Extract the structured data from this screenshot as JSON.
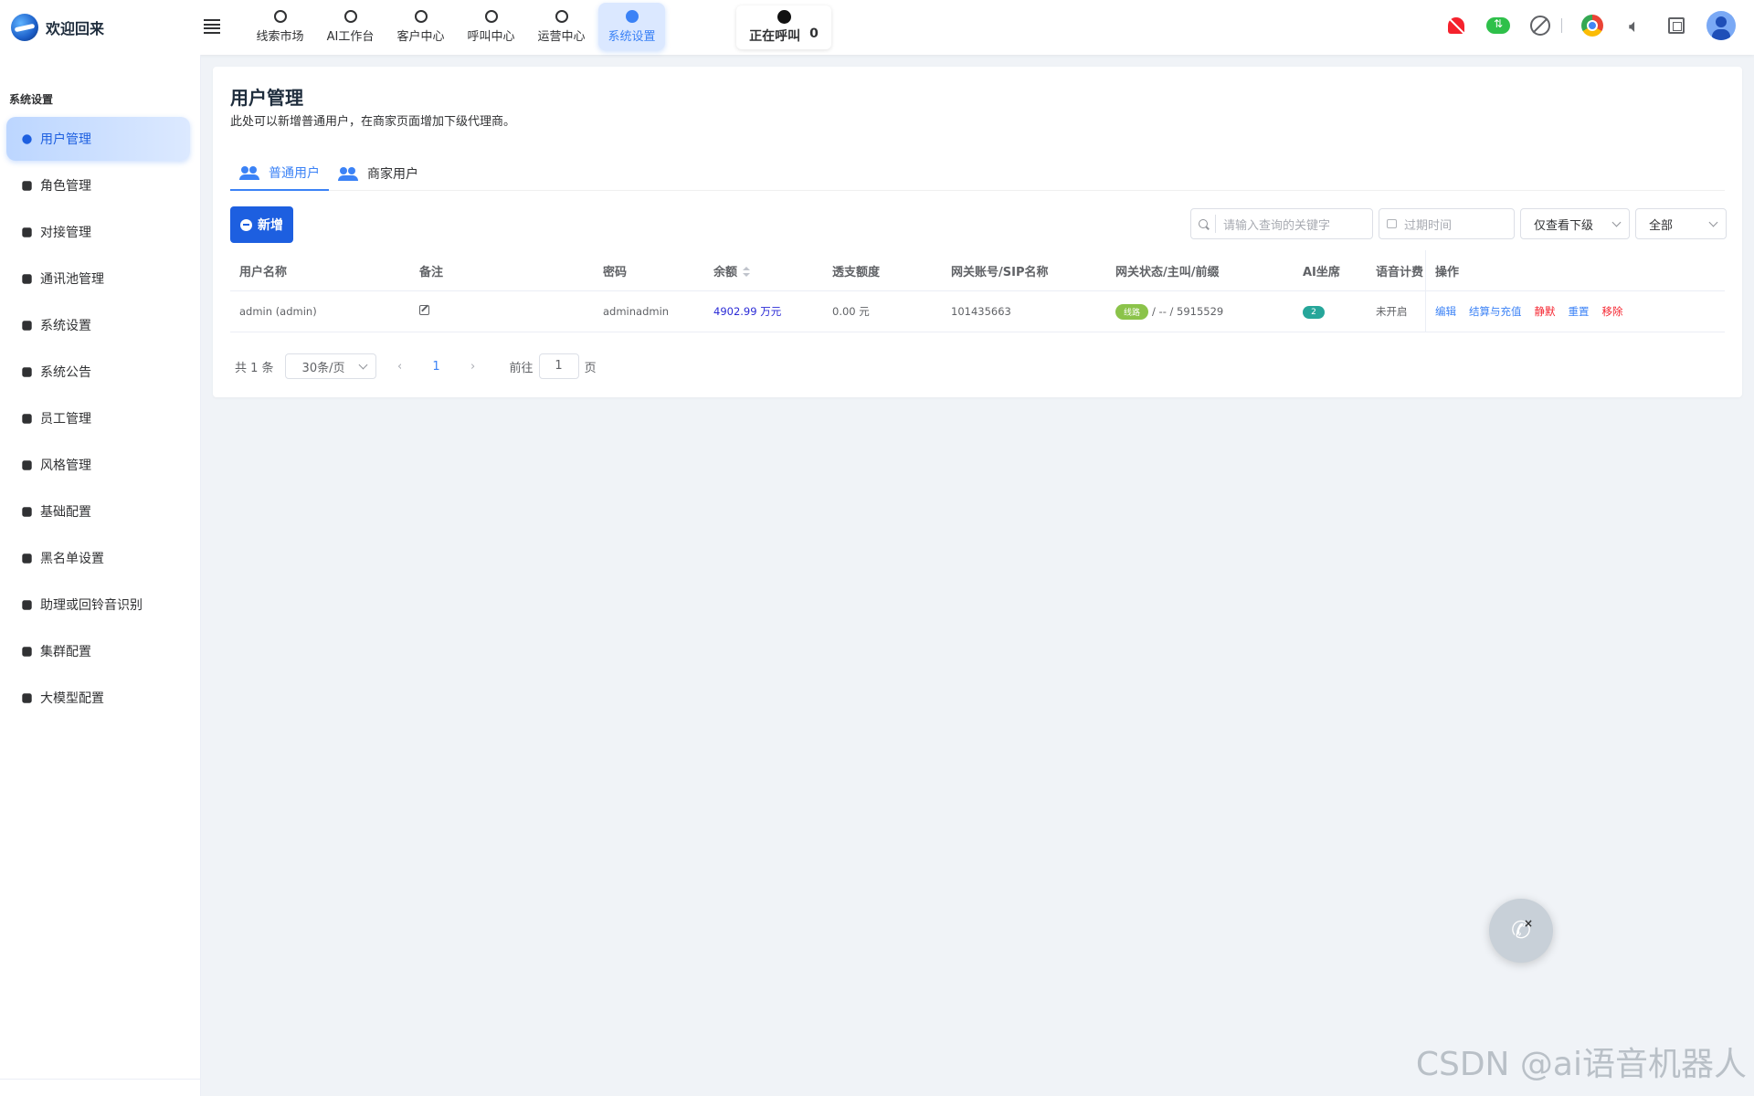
{
  "header": {
    "brand_title": "欢迎回来",
    "nav": [
      {
        "label": "线索市场",
        "icon": "clue-icon"
      },
      {
        "label": "AI工作台",
        "icon": "ai-icon"
      },
      {
        "label": "客户中心",
        "icon": "customer-icon"
      },
      {
        "label": "呼叫中心",
        "icon": "headset-icon"
      },
      {
        "label": "运营中心",
        "icon": "operation-icon"
      },
      {
        "label": "系统设置",
        "icon": "gear-icon",
        "active": true
      }
    ],
    "calling_label": "正在呼叫",
    "calling_count": "0"
  },
  "sidebar": {
    "section_title": "系统设置",
    "items": [
      {
        "label": "用户管理",
        "active": true
      },
      {
        "label": "角色管理"
      },
      {
        "label": "对接管理"
      },
      {
        "label": "通讯池管理"
      },
      {
        "label": "系统设置"
      },
      {
        "label": "系统公告"
      },
      {
        "label": "员工管理"
      },
      {
        "label": "风格管理"
      },
      {
        "label": "基础配置"
      },
      {
        "label": "黑名单设置"
      },
      {
        "label": "助理或回铃音识别"
      },
      {
        "label": "集群配置"
      },
      {
        "label": "大模型配置"
      }
    ]
  },
  "main": {
    "title": "用户管理",
    "description": "此处可以新增普通用户，在商家页面增加下级代理商。",
    "tabs": [
      {
        "label": "普通用户",
        "active": true
      },
      {
        "label": "商家用户"
      }
    ],
    "add_button": "新增",
    "search_placeholder": "请输入查询的关键字",
    "date_placeholder": "过期时间",
    "filter_scope": "仅查看下级",
    "filter_all": "全部",
    "table": {
      "columns": [
        "用户名称",
        "备注",
        "密码",
        "余额",
        "透支额度",
        "网关账号/SIP名称",
        "网关状态/主叫/前缀",
        "AI坐席",
        "语音计费",
        "操作"
      ],
      "rows": [
        {
          "name": "admin (admin)",
          "password": "adminadmin",
          "balance": "4902.99 万元",
          "overdraft": "0.00 元",
          "gateway": "101435663",
          "gateway_status_badge": "线路",
          "gateway_status_text": "/ -- / 5915529",
          "ai_seats": "2",
          "voice_billing": "未开启",
          "actions": [
            "编辑",
            "结算与充值",
            "静默",
            "重置",
            "移除"
          ]
        }
      ]
    },
    "pagination": {
      "total": "共 1 条",
      "page_size": "30条/页",
      "current_page": "1",
      "goto_label": "前往",
      "goto_value": "1",
      "page_suffix": "页"
    }
  },
  "watermark": "CSDN @ai语音机器人",
  "colors": {
    "primary": "#1d5fe0",
    "accent": "#3b82f6",
    "danger": "#f5222d",
    "success": "#2ec04a"
  }
}
